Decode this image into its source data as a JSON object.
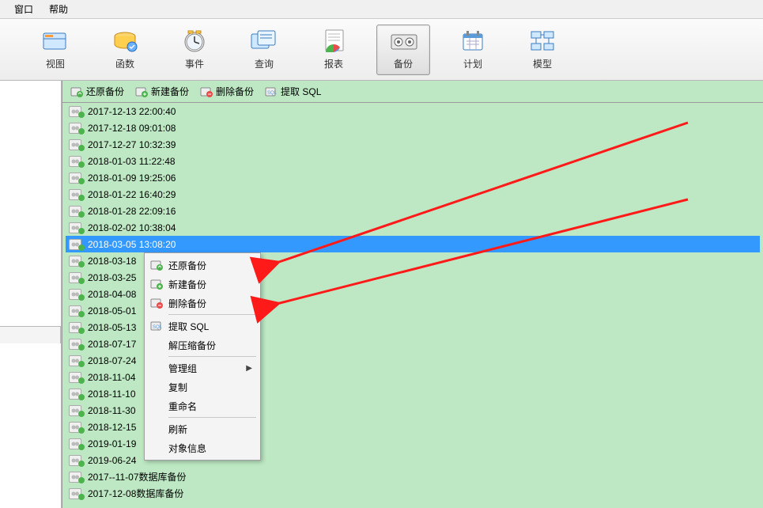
{
  "menubar": {
    "window": "窗口",
    "help": "帮助"
  },
  "toolbar": {
    "view": "视图",
    "function": "函数",
    "event": "事件",
    "query": "查询",
    "report": "报表",
    "backup": "备份",
    "schedule": "计划",
    "model": "模型"
  },
  "actions": {
    "restore": "还原备份",
    "new": "新建备份",
    "delete": "删除备份",
    "extract_sql": "提取 SQL"
  },
  "list": [
    "2017-12-13 22:00:40",
    "2017-12-18 09:01:08",
    "2017-12-27 10:32:39",
    "2018-01-03 11:22:48",
    "2018-01-09 19:25:06",
    "2018-01-22 16:40:29",
    "2018-01-28 22:09:16",
    "2018-02-02 10:38:04",
    "2018-03-05 13:08:20",
    "2018-03-18",
    "2018-03-25",
    "2018-04-08",
    "2018-05-01",
    "2018-05-13",
    "2018-07-17",
    "2018-07-24",
    "2018-11-04",
    "2018-11-10",
    "2018-11-30",
    "2018-12-15",
    "2019-01-19",
    "2019-06-24",
    "2017--11-07数据库备份",
    "2017-12-08数据库备份"
  ],
  "selected_index": 8,
  "context_menu": {
    "restore": "还原备份",
    "new": "新建备份",
    "delete": "删除备份",
    "extract_sql": "提取 SQL",
    "decompress": "解压缩备份",
    "manage_group": "管理组",
    "copy": "复制",
    "rename": "重命名",
    "refresh": "刷新",
    "object_info": "对象信息"
  }
}
